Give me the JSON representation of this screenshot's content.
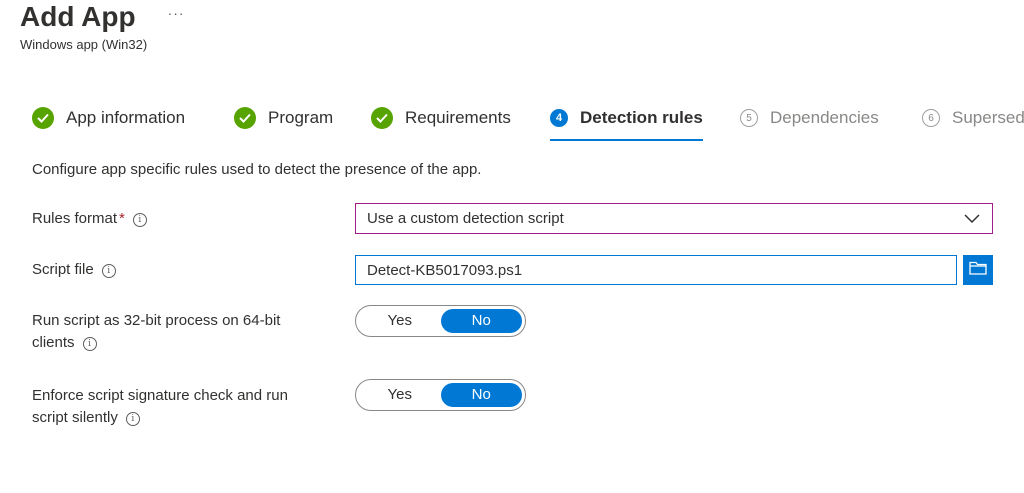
{
  "header": {
    "title": "Add App",
    "more": "···",
    "subtitle": "Windows app (Win32)"
  },
  "steps": [
    {
      "label": "App information",
      "state": "done"
    },
    {
      "label": "Program",
      "state": "done"
    },
    {
      "label": "Requirements",
      "state": "done"
    },
    {
      "number": "4",
      "label": "Detection rules",
      "state": "current"
    },
    {
      "number": "5",
      "label": "Dependencies",
      "state": "future"
    },
    {
      "number": "6",
      "label": "Supersed",
      "state": "future"
    }
  ],
  "description": "Configure app specific rules used to detect the presence of the app.",
  "fields": {
    "rules_format": {
      "label": "Rules format",
      "required_mark": "*",
      "value": "Use a custom detection script"
    },
    "script_file": {
      "label": "Script file",
      "value": "Detect-KB5017093.ps1"
    },
    "run_32bit": {
      "label_line1": "Run script as 32-bit process on 64-bit",
      "label_line2": "clients",
      "yes": "Yes",
      "no": "No",
      "selected": "No"
    },
    "enforce_signature": {
      "label_line1": "Enforce script signature check and run",
      "label_line2": "script silently",
      "yes": "Yes",
      "no": "No",
      "selected": "No"
    }
  },
  "icons": {
    "check": "checkmark-icon",
    "info": "info-icon",
    "chevron": "chevron-down-icon",
    "folder": "folder-icon"
  },
  "colors": {
    "accent": "#0078d4",
    "success": "#57a300",
    "select_border": "#a01e8a",
    "required": "#a4262c",
    "disabled_text": "#8a8886"
  }
}
